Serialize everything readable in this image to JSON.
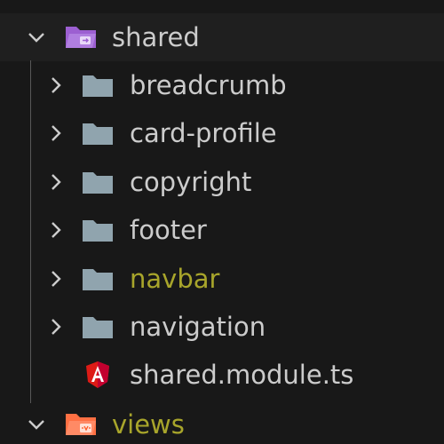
{
  "explorer": {
    "shared_folder": {
      "label": "shared",
      "icon": "folder-shared-open-icon",
      "expanded": true
    },
    "children": [
      {
        "label": "breadcrumb",
        "icon": "folder-icon",
        "color": "#cccccc"
      },
      {
        "label": "card-profile",
        "icon": "folder-icon",
        "color": "#cccccc"
      },
      {
        "label": "copyright",
        "icon": "folder-icon",
        "color": "#cccccc"
      },
      {
        "label": "footer",
        "icon": "folder-icon",
        "color": "#cccccc"
      },
      {
        "label": "navbar",
        "icon": "folder-icon",
        "color": "#a8a52b"
      },
      {
        "label": "navigation",
        "icon": "folder-icon",
        "color": "#cccccc"
      }
    ],
    "module_file": {
      "label": "shared.module.ts",
      "icon": "angular-icon"
    },
    "views_folder": {
      "label": "views",
      "icon": "folder-views-open-icon",
      "color": "#a8a52b",
      "expanded": true
    }
  },
  "colors": {
    "background": "#181818",
    "header_background": "#1f1f1f",
    "text": "#cccccc",
    "modified_text": "#a8a52b",
    "folder_gray": "#90a4ae",
    "shared_purple": "#9c5fd1",
    "views_orange": "#ff7043",
    "angular_red": "#dd1b16"
  }
}
